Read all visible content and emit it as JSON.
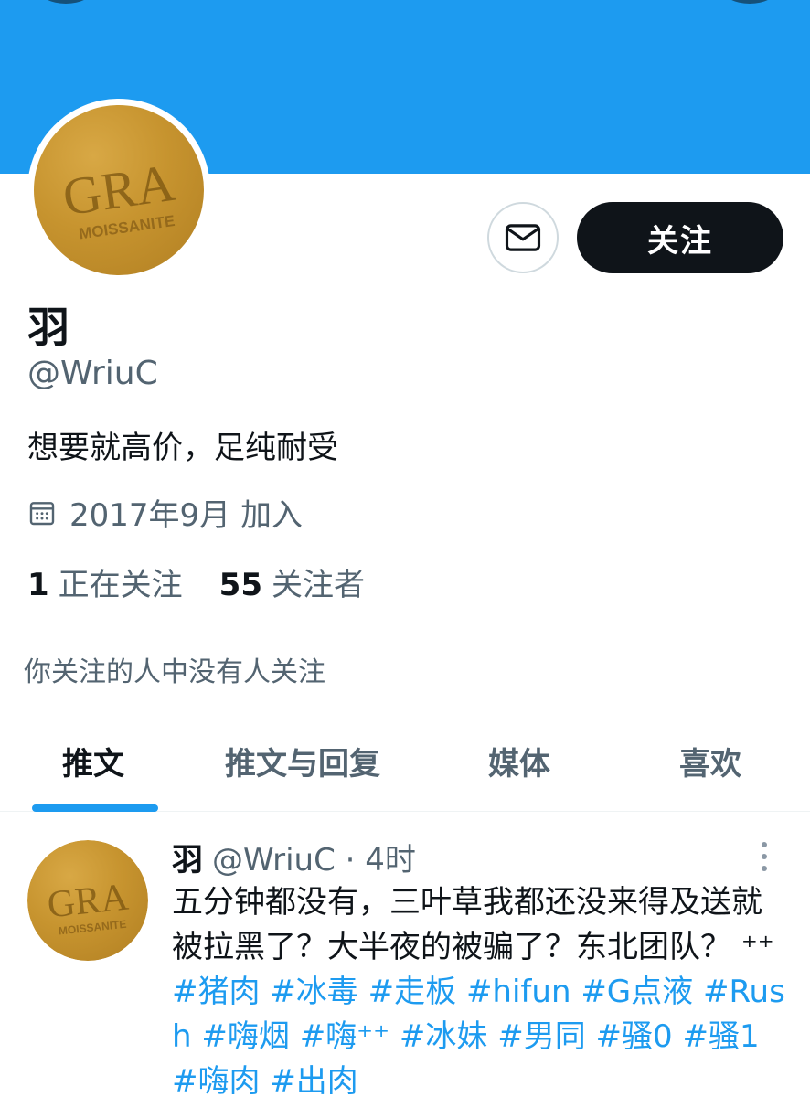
{
  "colors": {
    "accent": "#1d9bf0",
    "text": "#0f1419",
    "secondary": "#536471"
  },
  "profile": {
    "display_name": "羽",
    "handle": "@WriuC",
    "bio": "想要就高价，足纯耐受",
    "joined": "2017年9月 加入",
    "following_count": "1",
    "following_label": "正在关注",
    "followers_count": "55",
    "followers_label": "关注者",
    "followed_by_note": "你关注的人中没有人关注",
    "avatar_text": {
      "brand": "GRA",
      "sub": "MOISSANITE"
    }
  },
  "actions": {
    "follow_label": "关注",
    "message_icon": "envelope-icon"
  },
  "tabs": [
    {
      "label": "推文",
      "active": true
    },
    {
      "label": "推文与回复",
      "active": false
    },
    {
      "label": "媒体",
      "active": false
    },
    {
      "label": "喜欢",
      "active": false
    }
  ],
  "tweet": {
    "name": "羽",
    "handle": "@WriuC",
    "time": "· 4时",
    "text_plain": "五分钟都没有，三叶草我都还没来得及送就被拉黑了？大半夜的被骗了？东北团队？",
    "emoji": "⁺⁺",
    "hashtags": [
      "#猪肉",
      "#冰毒",
      "#走板",
      "#hifun",
      "#G点液",
      "#Rush",
      "#嗨烟",
      "#嗨⁺⁺",
      "#冰妹",
      "#男同",
      "#骚0",
      "#骚1",
      "#嗨肉",
      "#出肉"
    ]
  }
}
